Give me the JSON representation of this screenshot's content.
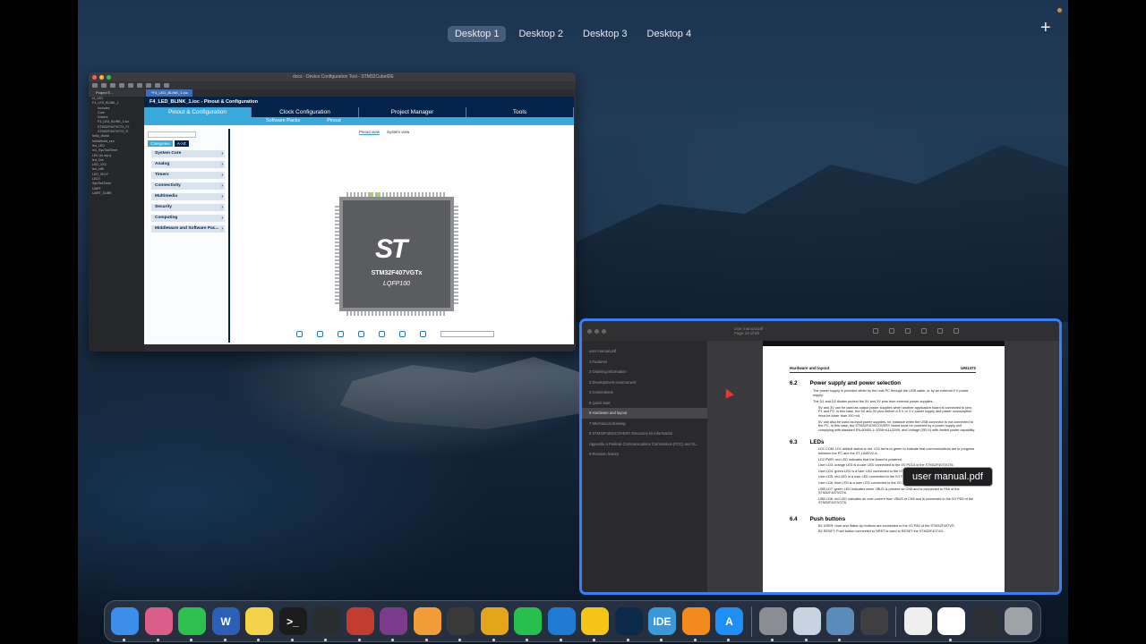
{
  "spaces": [
    "Desktop 1",
    "Desktop 2",
    "Desktop 3",
    "Desktop 4"
  ],
  "active_space": "Desktop 1",
  "add_space_label": "+",
  "ide": {
    "window_title": "docs - Device Configuration Tool - STM32CubeIDE",
    "explorer_tab": "Project E...",
    "tree": [
      "t4_LED",
      "F4_LED_BLINK_1",
      "Includes",
      "Core",
      "Drivers",
      "F4_LED_BLINK_1.ioc",
      "STM32F407VGTX_FL",
      "STM32F407VGTX_R",
      "hello_World",
      "helloWorld_sen",
      "led_LED",
      "m1_SysTickTimer",
      "LED (in rep1)",
      "led_Ors",
      "LED_VXC",
      "led_v88",
      "LED_SELF",
      "LEDT",
      "SysTickTimer",
      "UART",
      "UART_CUBE"
    ],
    "editor_tab": "*F4_LED_BLINK_1.ioc",
    "file_header": "F4_LED_BLINK_1.ioc - Pinout & Configuration",
    "tabs": [
      "Pinout & Configuration",
      "Clock Configuration",
      "Project Manager",
      "Tools"
    ],
    "subtabs": [
      "Software Packs",
      "Pinout"
    ],
    "cat_tabs": [
      "Categories",
      "A->Z"
    ],
    "categories": [
      "System Core",
      "Analog",
      "Timers",
      "Connectivity",
      "Multimedia",
      "Security",
      "Computing",
      "Middleware and Software Pac..."
    ],
    "view_tabs": [
      "Pinout view",
      "System view"
    ],
    "chip_logo": "ST",
    "chip_name": "STM32F407VGTx",
    "chip_package": "LQFP100"
  },
  "pdf": {
    "window_title": "user manual.pdf",
    "page_info": "Page 19 of 50",
    "label": "user manual.pdf",
    "toc": [
      "user manual.pdf",
      "1 Features",
      "2 Ordering information",
      "3 Development environment",
      "4 Conventions",
      "5 Quick start",
      "6 Hardware and layout",
      "7 Mechanical drawing",
      "8 STM32F4DISCOVERY Discovery kit information",
      "Appendix A Federal Communications Commission (FCC) and IS...",
      "9 Revision history"
    ],
    "toc_selected_index": 6,
    "header_left": "Hardware and layout",
    "header_right": "UM1472",
    "sec1_num": "6.2",
    "sec1_title": "Power supply and power selection",
    "sec1_para1": "The power supply is provided either by the host PC through the USB cable, or by an external 5 V power supply.",
    "sec1_para2": "The D1 and D2 diodes protect the 5V and 3V pins from external power supplies:",
    "sec1_b1": "5V and 3V can be used as output power supplies when another application board is connected to pins P1 and P2. In this case, the 5V and 3V pins deliver a 5 V or 3 V power supply and power consumption must be lower than 100 mA.",
    "sec1_b2": "5V can also be used as input power supplies, for instance when the USB connector is not connected to the PC. In this case, the STM32F4DISCOVERY board must be powered by a power supply unit complying with standard EN-60950-1: 2006+A11/2009, and Voltage (SELV) with limited power capability.",
    "sec2_num": "6.3",
    "sec2_title": "LEDs",
    "leds": [
      "LD1 COM: LD1 default status is red. LD1 turns to green to indicate that communications are in progress between the PC and the ST-LINK/V2-A.",
      "LD2 PWR: red LED indicates that the board is powered.",
      "User LD3: orange LED is a user LED connected to the I/O PD13 of the STM32F407VGT6.",
      "User LD4: green LED is a user LED connected to the I/O PD12 of the STM32F407VGT6.",
      "User LD5: red LED is a user LED connected to the I/O PD14 of the STM32F407VGT6.",
      "User LD6: blue LED is a user LED connected to the I/O PD15 of the STM32F407VGT6.",
      "USB LD7: green LED indicates when VBUS is present on CN5 and is connected to PA9 of the STM32F407VGT6.",
      "USB LD8: red LED indicates an over-current from VBUS of CN5 and is connected to the I/O PD5 of the STM32F407VGT6."
    ],
    "sec3_num": "6.4",
    "sec3_title": "Push buttons",
    "buttons": [
      "B1 USER: User and Wake-Up buttons are connected to the I/O PA0 of the STM32F407VG.",
      "B2 RESET: Push button connected to NRST is used to RESET the STM32F407VG."
    ]
  },
  "dock": [
    {
      "name": "finder-icon",
      "label": "",
      "color": "#3d8ee8"
    },
    {
      "name": "launchpad-icon",
      "label": "",
      "color": "#d95f8a"
    },
    {
      "name": "facetime-icon",
      "label": "",
      "color": "#2fbf4f"
    },
    {
      "name": "word-icon",
      "label": "W",
      "color": "#2b5fb8"
    },
    {
      "name": "notes-icon",
      "label": "",
      "color": "#f4d24a"
    },
    {
      "name": "terminal-icon",
      "label": ">_",
      "color": "#1c1c1e"
    },
    {
      "name": "activity-monitor-icon",
      "label": "",
      "color": "#2a2d2f"
    },
    {
      "name": "pdf-tool-icon",
      "label": "",
      "color": "#c23b2e"
    },
    {
      "name": "winrar-icon",
      "label": "",
      "color": "#7a3b8a"
    },
    {
      "name": "photos-icon",
      "label": "",
      "color": "#f29d3a"
    },
    {
      "name": "davinci-icon",
      "label": "",
      "color": "#3a3a3a"
    },
    {
      "name": "chrome-icon",
      "label": "",
      "color": "#e4a51e"
    },
    {
      "name": "whatsapp-icon",
      "label": "",
      "color": "#27c04f"
    },
    {
      "name": "vscode-icon",
      "label": "",
      "color": "#1f7ad1"
    },
    {
      "name": "cyberghost-icon",
      "label": "",
      "color": "#f5c518"
    },
    {
      "name": "cubemx-icon",
      "label": "",
      "color": "#0c2b4a"
    },
    {
      "name": "stm32cubeide-icon",
      "label": "IDE",
      "color": "#3a9ad9"
    },
    {
      "name": "sublime-icon",
      "label": "",
      "color": "#f28a1e"
    },
    {
      "name": "appstore-icon",
      "label": "A",
      "color": "#1f8ef5"
    },
    {
      "name": "system-preferences-icon",
      "label": "",
      "color": "#8a8d92"
    },
    {
      "name": "preview-icon",
      "label": "",
      "color": "#c7d3de"
    },
    {
      "name": "quicktime-icon",
      "label": "",
      "color": "#5b8bb8"
    },
    {
      "name": "calculator-icon",
      "label": "",
      "color": "#3f3f42"
    },
    {
      "name": "document-icon",
      "label": "",
      "color": "#eeeeee"
    },
    {
      "name": "downloads-folder-icon",
      "label": "",
      "color": "#ffffff"
    },
    {
      "name": "screen-recording-icon",
      "label": "",
      "color": "#2c2f33"
    },
    {
      "name": "trash-icon",
      "label": "",
      "color": "#9ea3a8"
    }
  ]
}
